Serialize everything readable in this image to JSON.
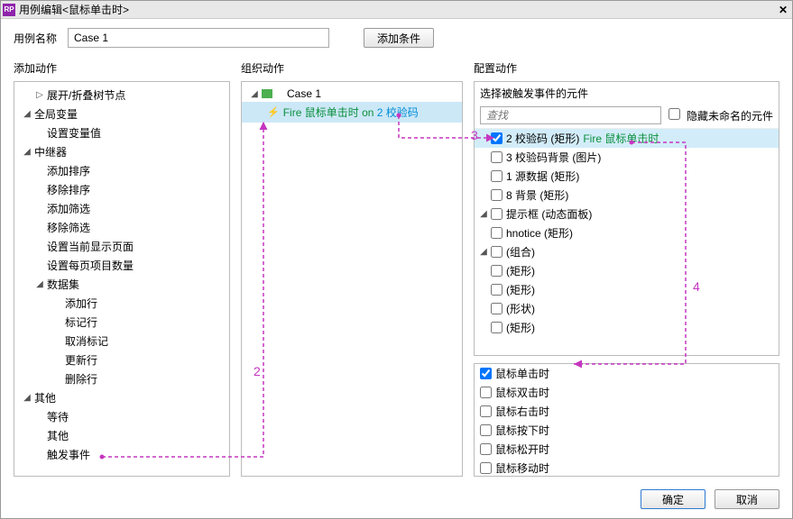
{
  "window": {
    "title": "用例编辑<鼠标单击时>",
    "icon_text": "RP"
  },
  "top": {
    "case_label": "用例名称",
    "case_value": "Case 1",
    "add_cond": "添加条件"
  },
  "col_titles": {
    "add": "添加动作",
    "org": "组织动作",
    "cfg": "配置动作"
  },
  "add_tree": [
    {
      "level": 1,
      "tw": "▷",
      "label": "展开/折叠树节点",
      "interact": true
    },
    {
      "level": 0,
      "tw": "◢",
      "label": "全局变量",
      "interact": true
    },
    {
      "level": 1,
      "tw": "",
      "label": "设置变量值",
      "interact": true
    },
    {
      "level": 0,
      "tw": "◢",
      "label": "中继器",
      "interact": true
    },
    {
      "level": 1,
      "tw": "",
      "label": "添加排序",
      "interact": true
    },
    {
      "level": 1,
      "tw": "",
      "label": "移除排序",
      "interact": true
    },
    {
      "level": 1,
      "tw": "",
      "label": "添加筛选",
      "interact": true
    },
    {
      "level": 1,
      "tw": "",
      "label": "移除筛选",
      "interact": true
    },
    {
      "level": 1,
      "tw": "",
      "label": "设置当前显示页面",
      "interact": true
    },
    {
      "level": 1,
      "tw": "",
      "label": "设置每页项目数量",
      "interact": true
    },
    {
      "level": 1,
      "tw": "◢",
      "label": "数据集",
      "interact": true
    },
    {
      "level": 2,
      "tw": "",
      "label": "添加行",
      "interact": true
    },
    {
      "level": 2,
      "tw": "",
      "label": "标记行",
      "interact": true
    },
    {
      "level": 2,
      "tw": "",
      "label": "取消标记",
      "interact": true
    },
    {
      "level": 2,
      "tw": "",
      "label": "更新行",
      "interact": true
    },
    {
      "level": 2,
      "tw": "",
      "label": "删除行",
      "interact": true
    },
    {
      "level": 0,
      "tw": "◢",
      "label": "其他",
      "interact": true
    },
    {
      "level": 1,
      "tw": "",
      "label": "等待",
      "interact": true
    },
    {
      "level": 1,
      "tw": "",
      "label": "其他",
      "interact": true
    },
    {
      "level": 1,
      "tw": "",
      "label": "触发事件",
      "interact": true
    }
  ],
  "org": {
    "case_label": "Case 1",
    "fire": {
      "fire": "Fire",
      "event": "鼠标单击时",
      "on": "on",
      "target": "2 校验码"
    }
  },
  "cfg": {
    "head": "选择被触发事件的元件",
    "search_placeholder": "查找",
    "hide_unnamed": "隐藏未命名的元件",
    "widgets": [
      {
        "level": 1,
        "tw": "",
        "checked": true,
        "label": "2 校验码 (矩形)",
        "extra": "Fire 鼠标单击时",
        "selected": true
      },
      {
        "level": 1,
        "tw": "",
        "checked": false,
        "label": "3 校验码背景 (图片)"
      },
      {
        "level": 1,
        "tw": "",
        "checked": false,
        "label": "1 源数据 (矩形)"
      },
      {
        "level": 1,
        "tw": "",
        "checked": false,
        "label": "8 背景 (矩形)"
      },
      {
        "level": 0,
        "tw": "◢",
        "checked": false,
        "label": "提示框 (动态面板)"
      },
      {
        "level": 1,
        "tw": "",
        "checked": false,
        "label": "hnotice (矩形)"
      },
      {
        "level": 1,
        "tw": "◢",
        "checked": false,
        "label": "(组合)"
      },
      {
        "level": 2,
        "tw": "",
        "checked": false,
        "label": "(矩形)"
      },
      {
        "level": 2,
        "tw": "",
        "checked": false,
        "label": "(矩形)"
      },
      {
        "level": 1,
        "tw": "",
        "checked": false,
        "label": "(形状)"
      },
      {
        "level": 1,
        "tw": "",
        "checked": false,
        "label": "(矩形)"
      }
    ],
    "events": [
      {
        "checked": true,
        "label": "鼠标单击时"
      },
      {
        "checked": false,
        "label": "鼠标双击时"
      },
      {
        "checked": false,
        "label": "鼠标右击时"
      },
      {
        "checked": false,
        "label": "鼠标按下时"
      },
      {
        "checked": false,
        "label": "鼠标松开时"
      },
      {
        "checked": false,
        "label": "鼠标移动时"
      }
    ]
  },
  "footer": {
    "ok": "确定",
    "cancel": "取消"
  },
  "annotations": {
    "n2": "2",
    "n3": "3",
    "n4": "4"
  }
}
